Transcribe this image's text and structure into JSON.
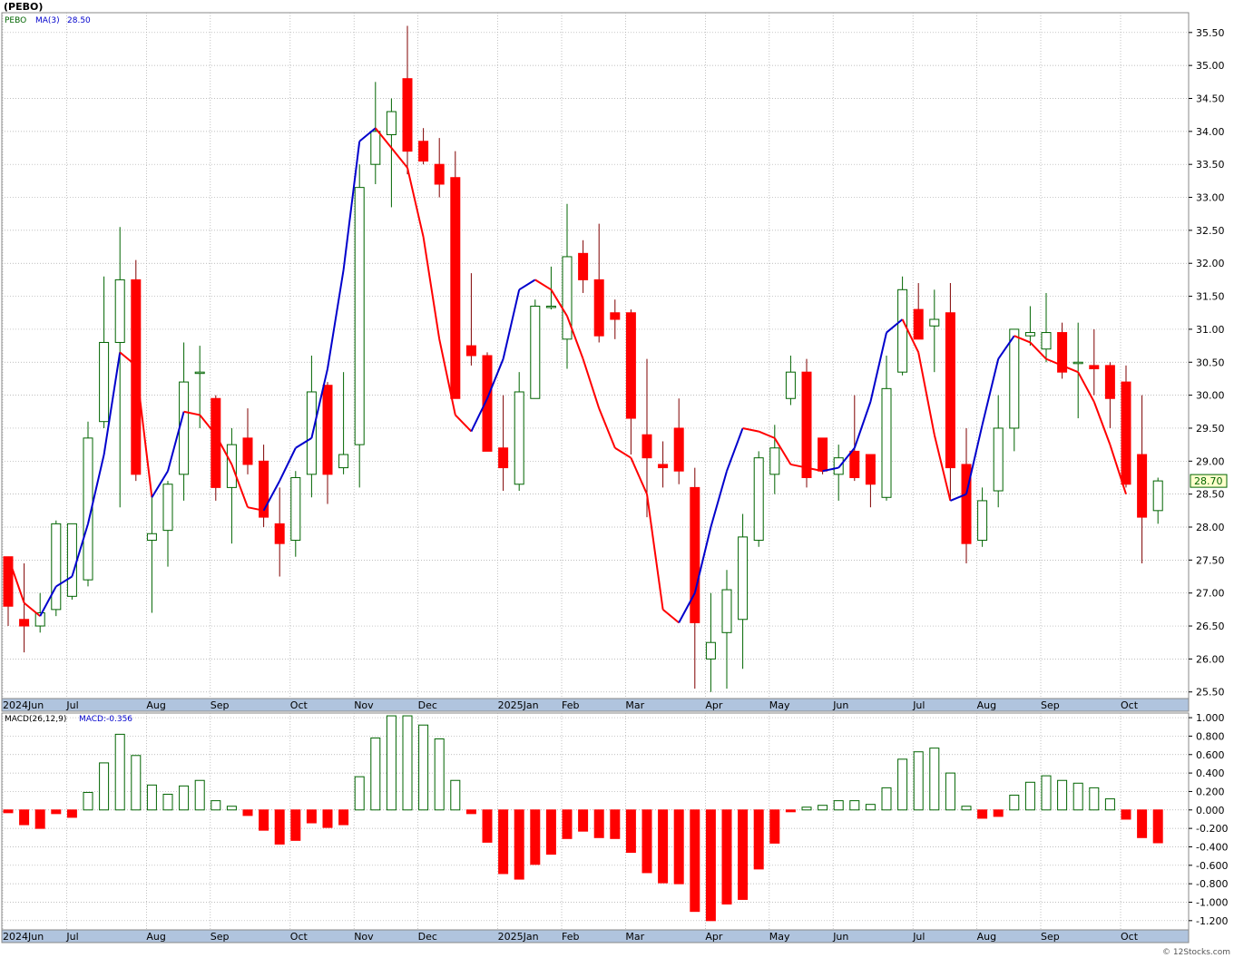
{
  "title": "(PEBO)",
  "copyright": "© 12Stocks.com",
  "colors": {
    "up": "#006400",
    "down": "#ff0000",
    "ma_up": "#0000cc",
    "ma_down": "#ff0000",
    "axis_band": "#b0c4de",
    "grid": "#a9a9a9"
  },
  "chart_data": [
    {
      "type": "candlestick",
      "legend": {
        "symbol": "PEBO",
        "ma_label": "MA(3)",
        "ma_value": "28.50"
      },
      "last_price_label": "28.70",
      "ylim": [
        25.4,
        35.8
      ],
      "y_ticks": [
        "25.50",
        "26.00",
        "26.50",
        "27.00",
        "27.50",
        "28.00",
        "28.50",
        "29.00",
        "29.50",
        "30.00",
        "30.50",
        "31.00",
        "31.50",
        "32.00",
        "32.50",
        "33.00",
        "33.50",
        "34.00",
        "34.50",
        "35.00",
        "35.50"
      ],
      "x_labels": [
        {
          "i": 0,
          "label": "2024Jun"
        },
        {
          "i": 4,
          "label": "Jul"
        },
        {
          "i": 9,
          "label": "Aug"
        },
        {
          "i": 13,
          "label": "Sep"
        },
        {
          "i": 18,
          "label": "Oct"
        },
        {
          "i": 22,
          "label": "Nov"
        },
        {
          "i": 26,
          "label": "Dec"
        },
        {
          "i": 31,
          "label": "2025Jan"
        },
        {
          "i": 35,
          "label": "Feb"
        },
        {
          "i": 39,
          "label": "Mar"
        },
        {
          "i": 44,
          "label": "Apr"
        },
        {
          "i": 48,
          "label": "May"
        },
        {
          "i": 52,
          "label": "Jun"
        },
        {
          "i": 57,
          "label": "Jul"
        },
        {
          "i": 61,
          "label": "Aug"
        },
        {
          "i": 65,
          "label": "Sep"
        },
        {
          "i": 70,
          "label": "Oct"
        }
      ],
      "candles": [
        [
          27.55,
          27.55,
          26.5,
          26.8
        ],
        [
          26.6,
          27.45,
          26.1,
          26.5
        ],
        [
          26.5,
          27.0,
          26.4,
          26.7
        ],
        [
          26.75,
          28.1,
          26.65,
          28.05
        ],
        [
          26.95,
          28.05,
          26.9,
          28.05
        ],
        [
          27.2,
          29.6,
          27.1,
          29.35
        ],
        [
          29.6,
          31.8,
          29.5,
          30.8
        ],
        [
          30.8,
          32.55,
          28.3,
          31.75
        ],
        [
          31.75,
          32.05,
          28.7,
          28.8
        ],
        [
          27.8,
          28.45,
          26.7,
          27.9
        ],
        [
          27.95,
          28.7,
          27.4,
          28.65
        ],
        [
          28.8,
          30.8,
          28.4,
          30.2
        ],
        [
          30.35,
          30.75,
          29.5,
          30.35
        ],
        [
          29.95,
          30.0,
          28.4,
          28.6
        ],
        [
          28.6,
          29.5,
          27.75,
          29.25
        ],
        [
          29.35,
          29.8,
          28.8,
          28.95
        ],
        [
          29.0,
          29.25,
          28.0,
          28.15
        ],
        [
          28.05,
          28.6,
          27.25,
          27.75
        ],
        [
          27.8,
          28.85,
          27.55,
          28.75
        ],
        [
          28.8,
          30.6,
          28.45,
          30.05
        ],
        [
          30.15,
          30.2,
          28.35,
          28.8
        ],
        [
          28.9,
          30.35,
          28.8,
          29.1
        ],
        [
          29.25,
          33.5,
          28.6,
          33.15
        ],
        [
          33.5,
          34.75,
          33.2,
          34.0
        ],
        [
          33.95,
          34.5,
          32.85,
          34.3
        ],
        [
          34.8,
          35.6,
          33.35,
          33.7
        ],
        [
          33.85,
          34.05,
          33.5,
          33.55
        ],
        [
          33.5,
          33.9,
          33.0,
          33.2
        ],
        [
          33.3,
          33.7,
          31.0,
          29.95
        ],
        [
          30.75,
          31.85,
          30.45,
          30.6
        ],
        [
          30.6,
          30.65,
          29.45,
          29.15
        ],
        [
          29.2,
          30.0,
          28.55,
          28.9
        ],
        [
          28.65,
          30.35,
          28.55,
          30.05
        ],
        [
          29.95,
          31.45,
          30.0,
          31.35
        ],
        [
          31.35,
          31.95,
          31.3,
          31.35
        ],
        [
          30.85,
          32.9,
          30.4,
          32.1
        ],
        [
          32.15,
          32.35,
          31.55,
          31.75
        ],
        [
          31.75,
          32.6,
          30.8,
          30.9
        ],
        [
          31.25,
          31.45,
          30.85,
          31.15
        ],
        [
          31.25,
          31.3,
          29.1,
          29.65
        ],
        [
          29.4,
          30.55,
          28.15,
          29.05
        ],
        [
          28.95,
          29.3,
          28.6,
          28.9
        ],
        [
          29.5,
          29.95,
          28.65,
          28.85
        ],
        [
          28.6,
          28.9,
          25.55,
          26.55
        ],
        [
          26.0,
          27.0,
          25.5,
          26.25
        ],
        [
          26.4,
          27.35,
          25.55,
          27.05
        ],
        [
          26.6,
          28.2,
          25.85,
          27.85
        ],
        [
          27.8,
          29.15,
          27.7,
          29.05
        ],
        [
          28.8,
          29.55,
          28.5,
          29.2
        ],
        [
          29.95,
          30.6,
          29.85,
          30.35
        ],
        [
          30.35,
          30.55,
          28.6,
          28.75
        ],
        [
          29.35,
          29.35,
          28.8,
          28.85
        ],
        [
          28.8,
          29.25,
          28.4,
          29.05
        ],
        [
          29.15,
          30.0,
          28.7,
          28.75
        ],
        [
          29.1,
          29.05,
          28.3,
          28.65
        ],
        [
          28.45,
          30.6,
          28.4,
          30.1
        ],
        [
          30.35,
          31.8,
          30.3,
          31.6
        ],
        [
          31.3,
          31.7,
          30.9,
          30.85
        ],
        [
          31.05,
          31.6,
          30.35,
          31.15
        ],
        [
          31.25,
          31.7,
          28.4,
          28.9
        ],
        [
          28.95,
          29.5,
          27.45,
          27.75
        ],
        [
          27.8,
          28.6,
          27.7,
          28.4
        ],
        [
          28.55,
          30.0,
          28.3,
          29.5
        ],
        [
          29.5,
          31.0,
          29.15,
          31.0
        ],
        [
          30.9,
          31.35,
          30.75,
          30.95
        ],
        [
          30.7,
          31.55,
          30.5,
          30.95
        ],
        [
          30.95,
          31.1,
          30.25,
          30.35
        ],
        [
          30.5,
          31.1,
          29.65,
          30.5
        ],
        [
          30.45,
          31.0,
          30.0,
          30.4
        ],
        [
          30.45,
          30.5,
          29.5,
          29.95
        ],
        [
          30.2,
          30.45,
          28.6,
          28.65
        ],
        [
          29.1,
          30.0,
          27.45,
          28.15
        ],
        [
          28.25,
          28.75,
          28.05,
          28.7
        ]
      ],
      "ma": [
        27.55,
        26.85,
        26.65,
        27.1,
        27.25,
        28.05,
        29.1,
        30.65,
        30.45,
        28.45,
        28.85,
        29.75,
        29.7,
        29.4,
        28.95,
        28.3,
        28.25,
        28.7,
        29.2,
        29.35,
        30.4,
        31.9,
        33.85,
        34.05,
        33.75,
        33.45,
        32.4,
        30.85,
        29.7,
        29.45,
        29.95,
        30.55,
        31.6,
        31.75,
        31.6,
        31.2,
        30.55,
        29.8,
        29.2,
        29.05,
        28.5,
        26.75,
        26.55,
        27.0,
        28.0,
        28.85,
        29.5,
        29.45,
        29.35,
        28.95,
        28.9,
        28.85,
        28.9,
        29.2,
        29.9,
        30.95,
        31.15,
        30.65,
        29.4,
        28.4,
        28.5,
        29.55,
        30.55,
        30.9,
        30.8,
        30.55,
        30.45,
        30.35,
        29.9,
        29.25,
        28.5
      ],
      "ma_offset": 2
    },
    {
      "type": "bar",
      "legend": {
        "label": "MACD(26,12,9)",
        "value_label": "MACD:-0.356"
      },
      "ylim": [
        -1.3,
        1.05
      ],
      "y_ticks": [
        "-1.200",
        "-1.000",
        "-0.800",
        "-0.600",
        "-0.400",
        "-0.200",
        "0.000",
        "0.200",
        "0.400",
        "0.600",
        "0.800",
        "1.000"
      ],
      "values": [
        -0.03,
        -0.16,
        -0.2,
        -0.04,
        -0.08,
        0.19,
        0.51,
        0.82,
        0.59,
        0.27,
        0.17,
        0.26,
        0.32,
        0.1,
        0.04,
        -0.06,
        -0.22,
        -0.37,
        -0.33,
        -0.14,
        -0.19,
        -0.16,
        0.36,
        0.78,
        1.02,
        1.02,
        0.92,
        0.77,
        0.32,
        -0.04,
        -0.35,
        -0.69,
        -0.75,
        -0.59,
        -0.48,
        -0.31,
        -0.23,
        -0.3,
        -0.31,
        -0.46,
        -0.68,
        -0.79,
        -0.8,
        -1.1,
        -1.2,
        -1.02,
        -0.97,
        -0.64,
        -0.36,
        -0.02,
        0.03,
        0.05,
        0.1,
        0.1,
        0.06,
        0.24,
        0.55,
        0.63,
        0.67,
        0.4,
        0.04,
        -0.09,
        -0.07,
        0.16,
        0.3,
        0.37,
        0.32,
        0.29,
        0.24,
        0.12,
        -0.1,
        -0.3,
        -0.356
      ]
    }
  ]
}
